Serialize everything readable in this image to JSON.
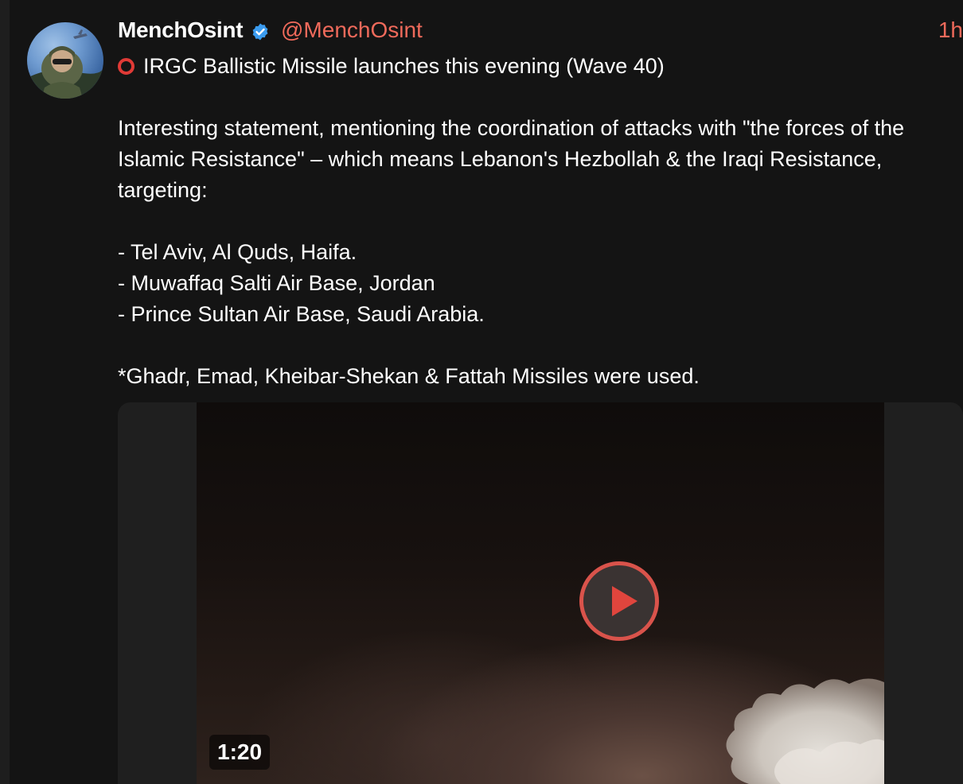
{
  "post": {
    "author": {
      "display_name": "MenchOsint",
      "handle": "@MenchOsint",
      "verified": true
    },
    "time": "1h",
    "headline_icon": "red-hollow-circle",
    "headline": "IRGC Ballistic Missile launches this evening (Wave 40)",
    "paragraph_1": "Interesting statement, mentioning the coordination of attacks with \"the forces of the Islamic Resistance\" – which means Lebanon's Hezbollah & the Iraqi Resistance, targeting:",
    "targets": [
      "- Tel Aviv, Al Quds, Haifa.",
      "- Muwaffaq Salti Air Base, Jordan",
      "- Prince Sultan Air Base, Saudi Arabia."
    ],
    "footnote": "*Ghadr, Emad, Kheibar-Shekan & Fattah Missiles were used.",
    "media": {
      "type": "video",
      "duration": "1:20",
      "play_icon": "play-icon"
    }
  },
  "colors": {
    "background": "#141414",
    "accent": "#ef6a5b",
    "play_ring": "#d9534b",
    "verified": "#3b9cf0"
  }
}
